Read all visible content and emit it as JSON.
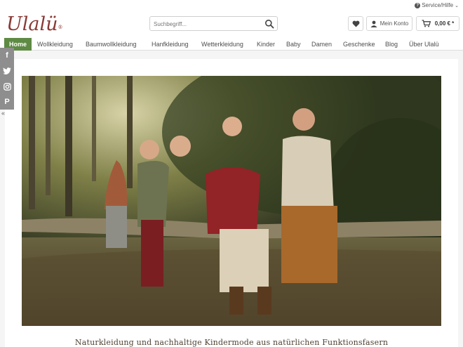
{
  "service": {
    "label": "Service/Hilfe"
  },
  "logo": {
    "text": "Ulalü",
    "mark": "®"
  },
  "search": {
    "placeholder": "Suchbegriff..."
  },
  "account": {
    "label": "Mein Konto"
  },
  "cart": {
    "amount": "0,00 € *"
  },
  "nav": {
    "items": [
      "Home",
      "Wollkleidung",
      "Baumwollkleidung",
      "Hanfkleidung",
      "Wetterkleidung",
      "Kinder",
      "Baby",
      "Damen",
      "Geschenke",
      "Blog",
      "Über Ulalü"
    ],
    "active": "Home"
  },
  "social": {
    "items": [
      "f",
      "twitter",
      "instagram",
      "pinterest"
    ]
  },
  "hero": {
    "alt": ""
  },
  "tagline": "Naturkleidung und nachhaltige Kindermode aus natürlichen Funktionsfasern",
  "colors": {
    "brand": "#8a3a36",
    "nav_active": "#5e8a43",
    "social": "#8e8e8e"
  }
}
